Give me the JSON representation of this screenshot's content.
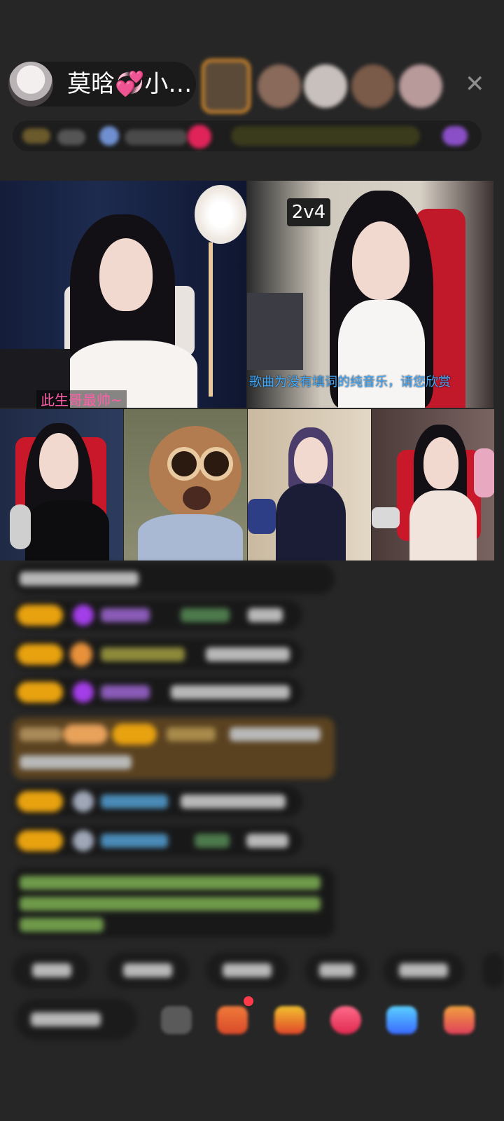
{
  "header": {
    "host_name": "莫晗💞小…",
    "close_glyph": "✕"
  },
  "video": {
    "badge_2v4": "2v4",
    "tile1_caption": "此生哥最帅~",
    "tile2_marquee": "歌曲为没有填词的纯音乐，请您欣赏"
  },
  "colors": {
    "background": "#262626",
    "level_badge": "#e8a20f",
    "caption_pink": "#ff5fa8",
    "marquee_blue": "#3ea9ff"
  }
}
